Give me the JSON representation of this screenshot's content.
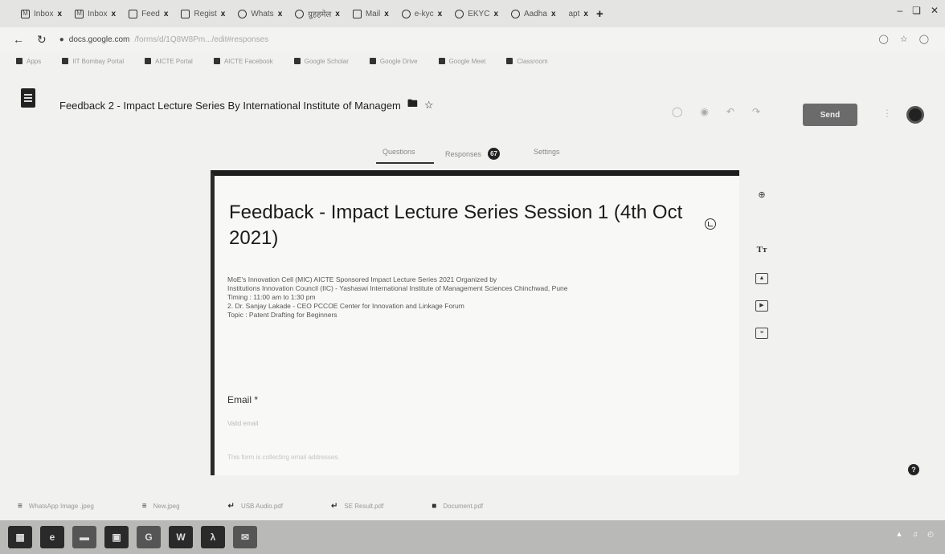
{
  "browser": {
    "tabs": [
      {
        "icon": "gmail-icon",
        "label": "Inbox"
      },
      {
        "icon": "gmail-icon",
        "label": "Inbox"
      },
      {
        "icon": "forms-icon",
        "label": "Feed"
      },
      {
        "icon": "forms-icon",
        "label": "Regist"
      },
      {
        "icon": "whatsapp-icon",
        "label": "Whats"
      },
      {
        "icon": "web-icon",
        "label": "ग्रुहहमेल"
      },
      {
        "icon": "mail-icon",
        "label": "Mail"
      },
      {
        "icon": "web-icon",
        "label": "e-kyc"
      },
      {
        "icon": "web-icon",
        "label": "EKYC"
      },
      {
        "icon": "web-icon",
        "label": "Aadha"
      },
      {
        "icon": "web-icon",
        "label": "apt"
      }
    ],
    "close_glyph": "x",
    "new_tab_glyph": "+",
    "url": "docs.google.com",
    "url_path": "/forms/d/1Q8W8Pm.../edit#responses",
    "bookmarks": [
      "Apps",
      "IIT Bombay Portal",
      "AICTE Portal",
      "AICTE Facebook",
      "Google Scholar",
      "Google Drive",
      "Google Meet",
      "Classroom"
    ],
    "downloads": [
      "WhatsApp Image .jpeg",
      "New.jpeg",
      "USB Audio.pdf",
      "SE Result.pdf",
      "Document.pdf"
    ]
  },
  "forms": {
    "doc_title": "Feedback 2 - Impact Lecture Series By International Institute of Managem",
    "send_label": "Send",
    "tabs": {
      "questions": "Questions",
      "responses": "Responses",
      "responses_count": "67",
      "settings": "Settings"
    },
    "heading": "Feedback - Impact Lecture Series Session 1 (4th Oct 2021)",
    "description": [
      "MoE's Innovation Cell (MIC) AICTE Sponsored Impact Lecture Series 2021 Organized by",
      "Institutions Innovation Council (IIC) - Yashaswi International Institute of Management Sciences Chinchwad, Pune",
      "Timing : 11:00 am to 1:30 pm",
      "2.    Dr. Sanjay Lakade - CEO PCCOE Center for Innovation and Linkage Forum",
      "Topic : Patent Drafting for Beginners"
    ],
    "email_label": "Email *",
    "email_placeholder": "Valid email",
    "email_hint": "This form is collecting email addresses."
  },
  "taskbar": {
    "apps": [
      "windows-start",
      "ie-icon",
      "explorer-icon",
      "store-icon",
      "chrome-icon",
      "word-icon",
      "acrobat-icon",
      "outlook-icon"
    ]
  }
}
